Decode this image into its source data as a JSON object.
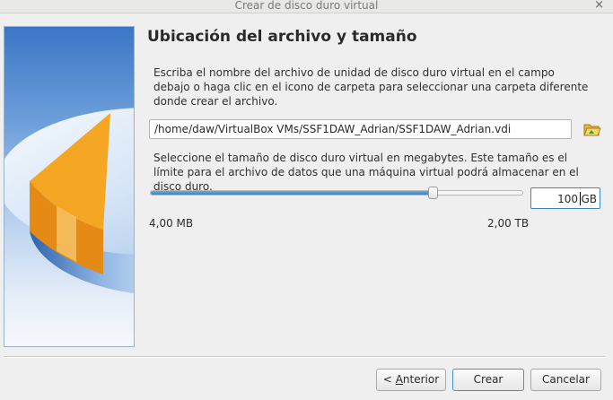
{
  "window": {
    "title": "Crear de disco duro virtual",
    "close_glyph": "×"
  },
  "page": {
    "heading": "Ubicación del archivo y tamaño",
    "location_description": "Escriba el nombre del archivo de unidad de disco duro virtual en el campo debajo o haga clic en el icono de carpeta para seleccionar una carpeta diferente donde crear el archivo.",
    "file_path": "/home/daw/VirtualBox VMs/SSF1DAW_Adrian/SSF1DAW_Adrian.vdi",
    "folder_icon": "folder-open-icon",
    "size_description": "Seleccione el tamaño de disco duro virtual en megabytes. Este tamaño es el límite para el archivo de datos que una máquina virtual podrá almacenar en el disco duro.",
    "size": {
      "value": "100",
      "unit": "GB",
      "slider_fraction": 0.76,
      "min_label": "4,00 MB",
      "max_label": "2,00 TB"
    }
  },
  "buttons": {
    "back": {
      "prefix": "< ",
      "mnemonic": "A",
      "rest": "nterior"
    },
    "create": "Crear",
    "cancel": "Cancelar"
  },
  "colors": {
    "accent": "#3c85c6",
    "disk_slice": "#f5a623",
    "sidebar_top": "#3b76c6"
  }
}
